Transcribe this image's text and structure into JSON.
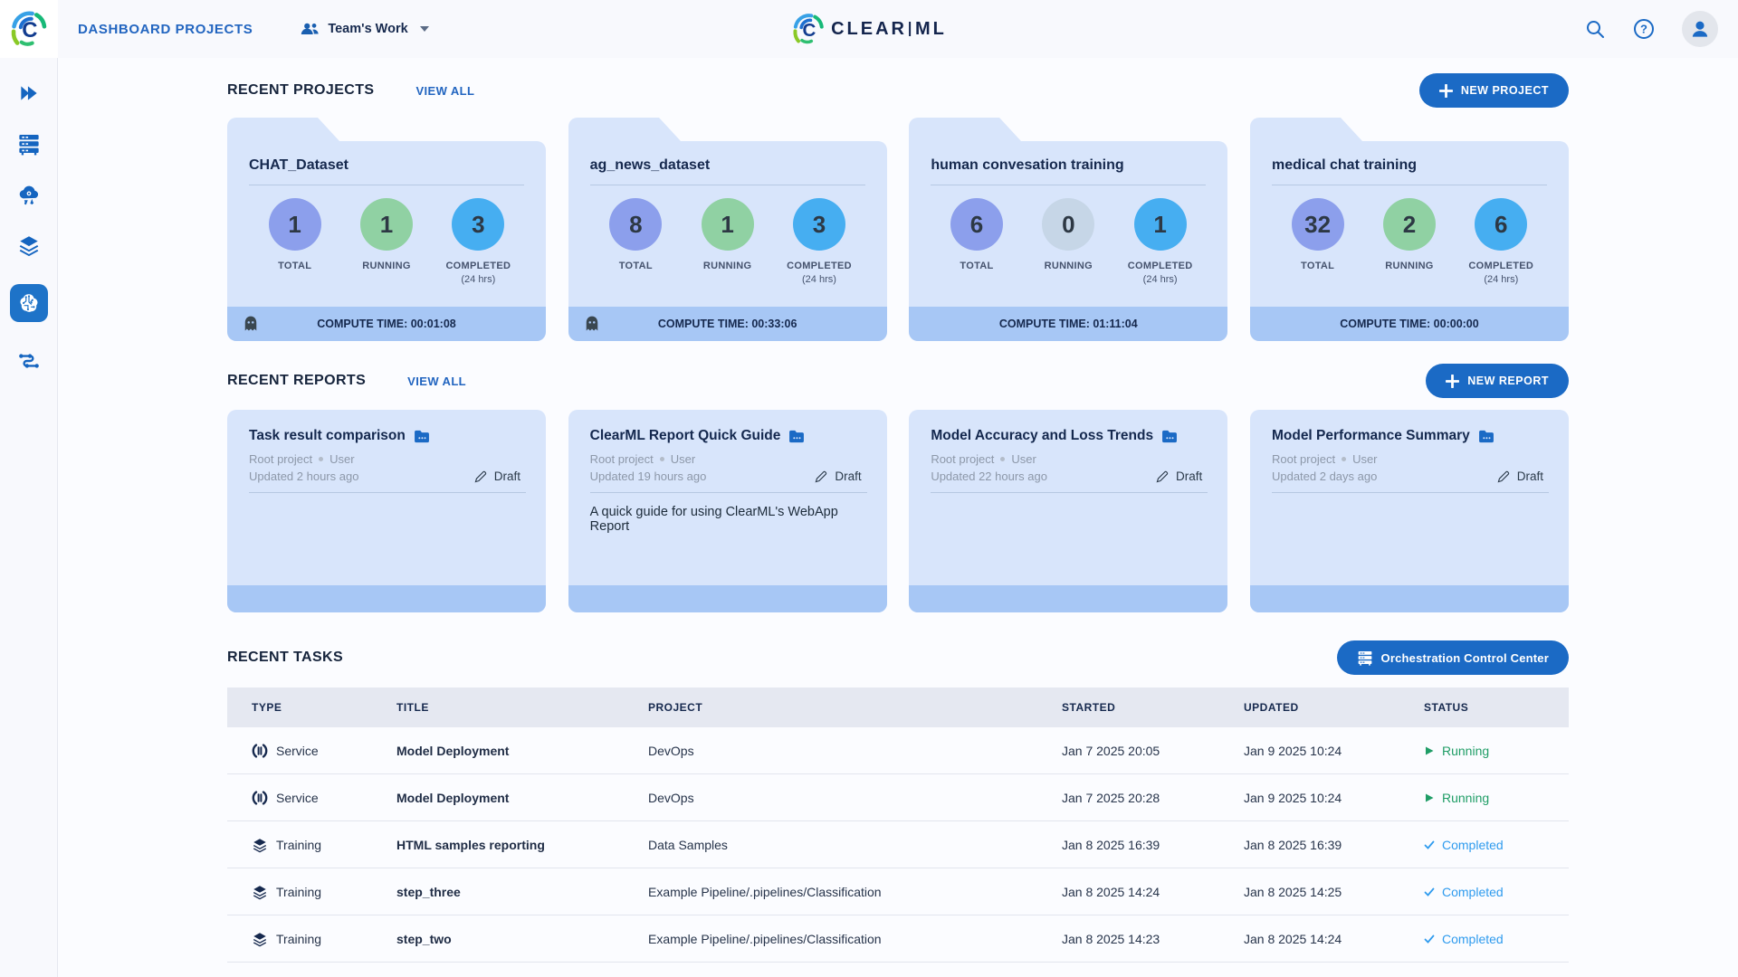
{
  "topbar": {
    "nav_title": "DASHBOARD PROJECTS",
    "workspace_label": "Team's Work",
    "logo_left": "CLEAR",
    "logo_right": "ML"
  },
  "sidebar": {
    "icons": [
      "double-chevron",
      "servers",
      "cloud-gear",
      "layers",
      "brain",
      "pipelines"
    ],
    "active_icon": "brain"
  },
  "projects": {
    "title": "RECENT PROJECTS",
    "view_all": "VIEW ALL",
    "new_button": "NEW PROJECT"
  },
  "stat_labels": {
    "total": "TOTAL",
    "running": "RUNNING",
    "completed": "COMPLETED",
    "completed_sub": "(24 hrs)"
  },
  "project_cards": [
    {
      "name": "CHAT_Dataset",
      "total": "1",
      "running": "1",
      "completed": "3",
      "compute_time": "COMPUTE TIME: 00:01:08",
      "has_ghost": true
    },
    {
      "name": "ag_news_dataset",
      "total": "8",
      "running": "1",
      "completed": "3",
      "compute_time": "COMPUTE TIME: 00:33:06",
      "has_ghost": true
    },
    {
      "name": "human convesation training",
      "total": "6",
      "running": "0",
      "completed": "1",
      "compute_time": "COMPUTE TIME: 01:11:04",
      "has_ghost": false
    },
    {
      "name": "medical chat training",
      "total": "32",
      "running": "2",
      "completed": "6",
      "compute_time": "COMPUTE TIME: 00:00:00",
      "has_ghost": false
    }
  ],
  "reports": {
    "title": "RECENT REPORTS",
    "view_all": "VIEW ALL",
    "new_button": "NEW REPORT"
  },
  "report_cards": [
    {
      "title": "Task result comparison",
      "project": "Root project",
      "author": "User",
      "updated": "Updated 2 hours ago",
      "status": "Draft",
      "description": ""
    },
    {
      "title": "ClearML Report Quick Guide",
      "project": "Root project",
      "author": "User",
      "updated": "Updated 19 hours ago",
      "status": "Draft",
      "description": "A quick guide for using ClearML's WebApp Report"
    },
    {
      "title": "Model Accuracy and Loss Trends",
      "project": "Root project",
      "author": "User",
      "updated": "Updated 22 hours ago",
      "status": "Draft",
      "description": ""
    },
    {
      "title": "Model Performance Summary",
      "project": "Root project",
      "author": "User",
      "updated": "Updated 2 days ago",
      "status": "Draft",
      "description": ""
    }
  ],
  "tasks": {
    "title": "RECENT TASKS",
    "orchestration_button": "Orchestration Control Center"
  },
  "table": {
    "headers": {
      "type": "TYPE",
      "title": "TITLE",
      "project": "PROJECT",
      "started": "STARTED",
      "updated": "UPDATED",
      "status": "STATUS"
    },
    "rows": [
      {
        "type": "Service",
        "title": "Model Deployment",
        "project": "DevOps",
        "started": "Jan 7 2025 20:05",
        "updated": "Jan 9 2025 10:24",
        "status": "Running"
      },
      {
        "type": "Service",
        "title": "Model Deployment",
        "project": "DevOps",
        "started": "Jan 7 2025 20:28",
        "updated": "Jan 9 2025 10:24",
        "status": "Running"
      },
      {
        "type": "Training",
        "title": "HTML samples reporting",
        "project": "Data Samples",
        "started": "Jan 8 2025 16:39",
        "updated": "Jan 8 2025 16:39",
        "status": "Completed"
      },
      {
        "type": "Training",
        "title": "step_three",
        "project": "Example Pipeline/.pipelines/Classification",
        "started": "Jan 8 2025 14:24",
        "updated": "Jan 8 2025 14:25",
        "status": "Completed"
      },
      {
        "type": "Training",
        "title": "step_two",
        "project": "Example Pipeline/.pipelines/Classification",
        "started": "Jan 8 2025 14:23",
        "updated": "Jan 8 2025 14:24",
        "status": "Completed"
      }
    ]
  },
  "colors": {
    "accent_blue": "#1b6ac5",
    "nav_blue": "#2265c0",
    "card_bg": "#d8e5fb",
    "card_footer": "#a7c7f5",
    "circle_total": "#8c9fec",
    "circle_running": "#90d1a3",
    "circle_running_zero": "#c6d6e7",
    "circle_completed": "#46aef1",
    "status_running": "#1f9d66",
    "status_completed": "#2f9bee",
    "table_header_bg": "#e5e8f1"
  }
}
